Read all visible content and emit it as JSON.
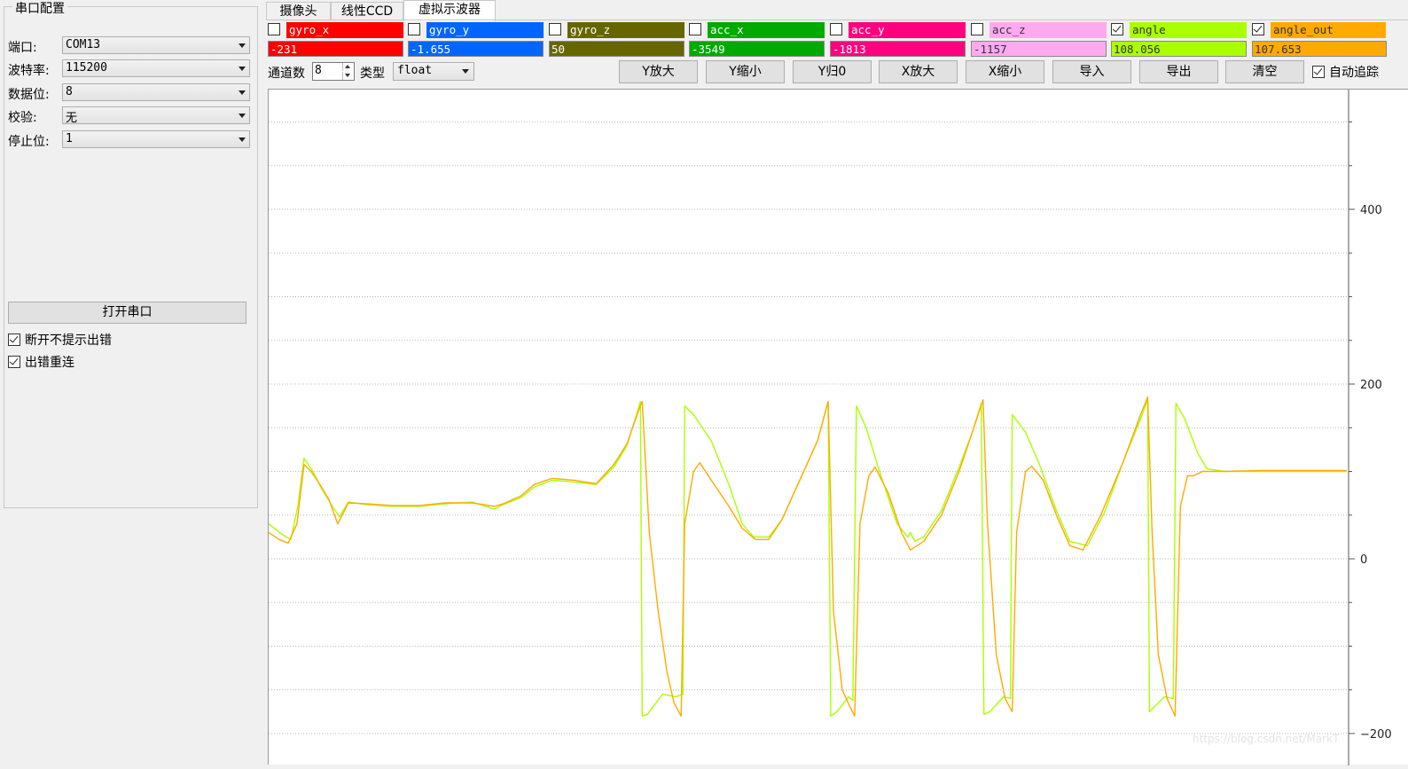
{
  "serial": {
    "group_title": "串口配置",
    "port": {
      "label": "端口:",
      "value": "COM13"
    },
    "baud": {
      "label": "波特率:",
      "value": "115200"
    },
    "databits": {
      "label": "数据位:",
      "value": "8"
    },
    "parity": {
      "label": "校验:",
      "value": "无"
    },
    "stopbits": {
      "label": "停止位:",
      "value": "1"
    },
    "open_button": "打开串口",
    "no_error_prompt": {
      "label": "断开不提示出错",
      "checked": true
    },
    "reconnect": {
      "label": "出错重连",
      "checked": true
    }
  },
  "tabs": [
    {
      "label": "摄像头",
      "active": false
    },
    {
      "label": "线性CCD",
      "active": false
    },
    {
      "label": "虚拟示波器",
      "active": true
    }
  ],
  "channels": [
    {
      "key": "gyro_x",
      "name": "gyro_x",
      "value": "-231",
      "checked": false,
      "color": "#ff0000"
    },
    {
      "key": "gyro_y",
      "name": "gyro_y",
      "value": "-1.655",
      "checked": false,
      "color": "#0066ff"
    },
    {
      "key": "gyro_z",
      "name": "gyro_z",
      "value": "50",
      "checked": false,
      "color": "#666600"
    },
    {
      "key": "acc_x",
      "name": "acc_x",
      "value": "-3549",
      "checked": false,
      "color": "#00aa00"
    },
    {
      "key": "acc_y",
      "name": "acc_y",
      "value": "-1813",
      "checked": false,
      "color": "#ff007f"
    },
    {
      "key": "acc_z",
      "name": "acc_z",
      "value": "-1157",
      "checked": false,
      "color": "#ffaaee"
    },
    {
      "key": "angle",
      "name": "angle",
      "value": "108.056",
      "checked": true,
      "color": "#aaff00"
    },
    {
      "key": "angle_out",
      "name": "angle_out",
      "value": "107.653",
      "checked": true,
      "color": "#ffaa00"
    }
  ],
  "toolbar": {
    "channel_count_label": "通道数",
    "channel_count": "8",
    "type_label": "类型",
    "type_value": "float",
    "buttons": [
      "Y放大",
      "Y缩小",
      "Y归0",
      "X放大",
      "X缩小",
      "导入",
      "导出",
      "清空"
    ],
    "auto_track": {
      "label": "自动追踪",
      "checked": true
    }
  },
  "chart_data": {
    "type": "line",
    "title": "",
    "xlabel": "",
    "ylabel": "",
    "ylim": [
      -225,
      525
    ],
    "xlim": [
      0,
      1220
    ],
    "y_ticks": [
      -200,
      0,
      200,
      400
    ],
    "grid": true,
    "grid_step": 50,
    "series": [
      {
        "name": "angle",
        "color": "#aaff00",
        "points": [
          [
            0,
            40
          ],
          [
            15,
            28
          ],
          [
            25,
            22
          ],
          [
            33,
            60
          ],
          [
            40,
            115
          ],
          [
            50,
            100
          ],
          [
            60,
            80
          ],
          [
            72,
            60
          ],
          [
            80,
            48
          ],
          [
            90,
            65
          ],
          [
            110,
            62
          ],
          [
            140,
            60
          ],
          [
            170,
            60
          ],
          [
            200,
            63
          ],
          [
            230,
            65
          ],
          [
            255,
            57
          ],
          [
            265,
            62
          ],
          [
            285,
            70
          ],
          [
            300,
            82
          ],
          [
            320,
            90
          ],
          [
            345,
            88
          ],
          [
            370,
            85
          ],
          [
            390,
            105
          ],
          [
            405,
            130
          ],
          [
            420,
            180
          ],
          [
            422,
            -180
          ],
          [
            428,
            -178
          ],
          [
            445,
            -155
          ],
          [
            460,
            -158
          ],
          [
            468,
            -155
          ],
          [
            470,
            175
          ],
          [
            480,
            165
          ],
          [
            500,
            135
          ],
          [
            520,
            85
          ],
          [
            535,
            40
          ],
          [
            548,
            25
          ],
          [
            565,
            25
          ],
          [
            580,
            45
          ],
          [
            600,
            90
          ],
          [
            620,
            135
          ],
          [
            632,
            180
          ],
          [
            635,
            -180
          ],
          [
            642,
            -175
          ],
          [
            655,
            -158
          ],
          [
            660,
            -162
          ],
          [
            664,
            175
          ],
          [
            675,
            150
          ],
          [
            690,
            100
          ],
          [
            710,
            40
          ],
          [
            722,
            25
          ],
          [
            725,
            30
          ],
          [
            730,
            20
          ],
          [
            740,
            25
          ],
          [
            760,
            55
          ],
          [
            780,
            105
          ],
          [
            795,
            145
          ],
          [
            805,
            178
          ],
          [
            808,
            -178
          ],
          [
            815,
            -175
          ],
          [
            830,
            -158
          ],
          [
            838,
            -160
          ],
          [
            840,
            165
          ],
          [
            855,
            145
          ],
          [
            870,
            110
          ],
          [
            890,
            55
          ],
          [
            905,
            20
          ],
          [
            925,
            15
          ],
          [
            945,
            55
          ],
          [
            965,
            110
          ],
          [
            985,
            160
          ],
          [
            993,
            182
          ],
          [
            995,
            -175
          ],
          [
            1000,
            -170
          ],
          [
            1012,
            -158
          ],
          [
            1022,
            -160
          ],
          [
            1025,
            178
          ],
          [
            1035,
            160
          ],
          [
            1050,
            120
          ],
          [
            1060,
            103
          ],
          [
            1080,
            100
          ],
          [
            1120,
            100
          ],
          [
            1160,
            100
          ],
          [
            1218,
            100
          ]
        ]
      },
      {
        "name": "angle_out",
        "color": "#ffaa00",
        "points": [
          [
            0,
            30
          ],
          [
            12,
            22
          ],
          [
            22,
            18
          ],
          [
            32,
            40
          ],
          [
            40,
            108
          ],
          [
            48,
            100
          ],
          [
            58,
            85
          ],
          [
            68,
            68
          ],
          [
            78,
            40
          ],
          [
            90,
            64
          ],
          [
            110,
            63
          ],
          [
            140,
            61
          ],
          [
            170,
            61
          ],
          [
            200,
            64
          ],
          [
            230,
            64
          ],
          [
            255,
            60
          ],
          [
            265,
            63
          ],
          [
            285,
            72
          ],
          [
            300,
            85
          ],
          [
            320,
            92
          ],
          [
            345,
            90
          ],
          [
            370,
            86
          ],
          [
            390,
            108
          ],
          [
            405,
            132
          ],
          [
            418,
            170
          ],
          [
            422,
            180
          ],
          [
            430,
            30
          ],
          [
            440,
            -60
          ],
          [
            450,
            -130
          ],
          [
            458,
            -165
          ],
          [
            466,
            -180
          ],
          [
            470,
            40
          ],
          [
            480,
            100
          ],
          [
            487,
            110
          ],
          [
            500,
            90
          ],
          [
            520,
            60
          ],
          [
            535,
            35
          ],
          [
            550,
            22
          ],
          [
            565,
            22
          ],
          [
            580,
            45
          ],
          [
            600,
            90
          ],
          [
            620,
            135
          ],
          [
            632,
            180
          ],
          [
            638,
            -60
          ],
          [
            648,
            -150
          ],
          [
            657,
            -170
          ],
          [
            662,
            -180
          ],
          [
            668,
            40
          ],
          [
            678,
            95
          ],
          [
            685,
            105
          ],
          [
            700,
            75
          ],
          [
            715,
            30
          ],
          [
            725,
            10
          ],
          [
            740,
            20
          ],
          [
            760,
            50
          ],
          [
            780,
            100
          ],
          [
            795,
            145
          ],
          [
            807,
            182
          ],
          [
            812,
            40
          ],
          [
            822,
            -110
          ],
          [
            832,
            -160
          ],
          [
            840,
            -175
          ],
          [
            845,
            30
          ],
          [
            855,
            100
          ],
          [
            862,
            106
          ],
          [
            875,
            90
          ],
          [
            890,
            50
          ],
          [
            905,
            15
          ],
          [
            920,
            10
          ],
          [
            940,
            50
          ],
          [
            965,
            110
          ],
          [
            985,
            165
          ],
          [
            993,
            185
          ],
          [
            998,
            30
          ],
          [
            1005,
            -110
          ],
          [
            1015,
            -160
          ],
          [
            1024,
            -180
          ],
          [
            1030,
            60
          ],
          [
            1038,
            95
          ],
          [
            1045,
            95
          ],
          [
            1055,
            100
          ],
          [
            1080,
            100
          ],
          [
            1120,
            101
          ],
          [
            1160,
            101
          ],
          [
            1218,
            101
          ]
        ]
      }
    ]
  }
}
